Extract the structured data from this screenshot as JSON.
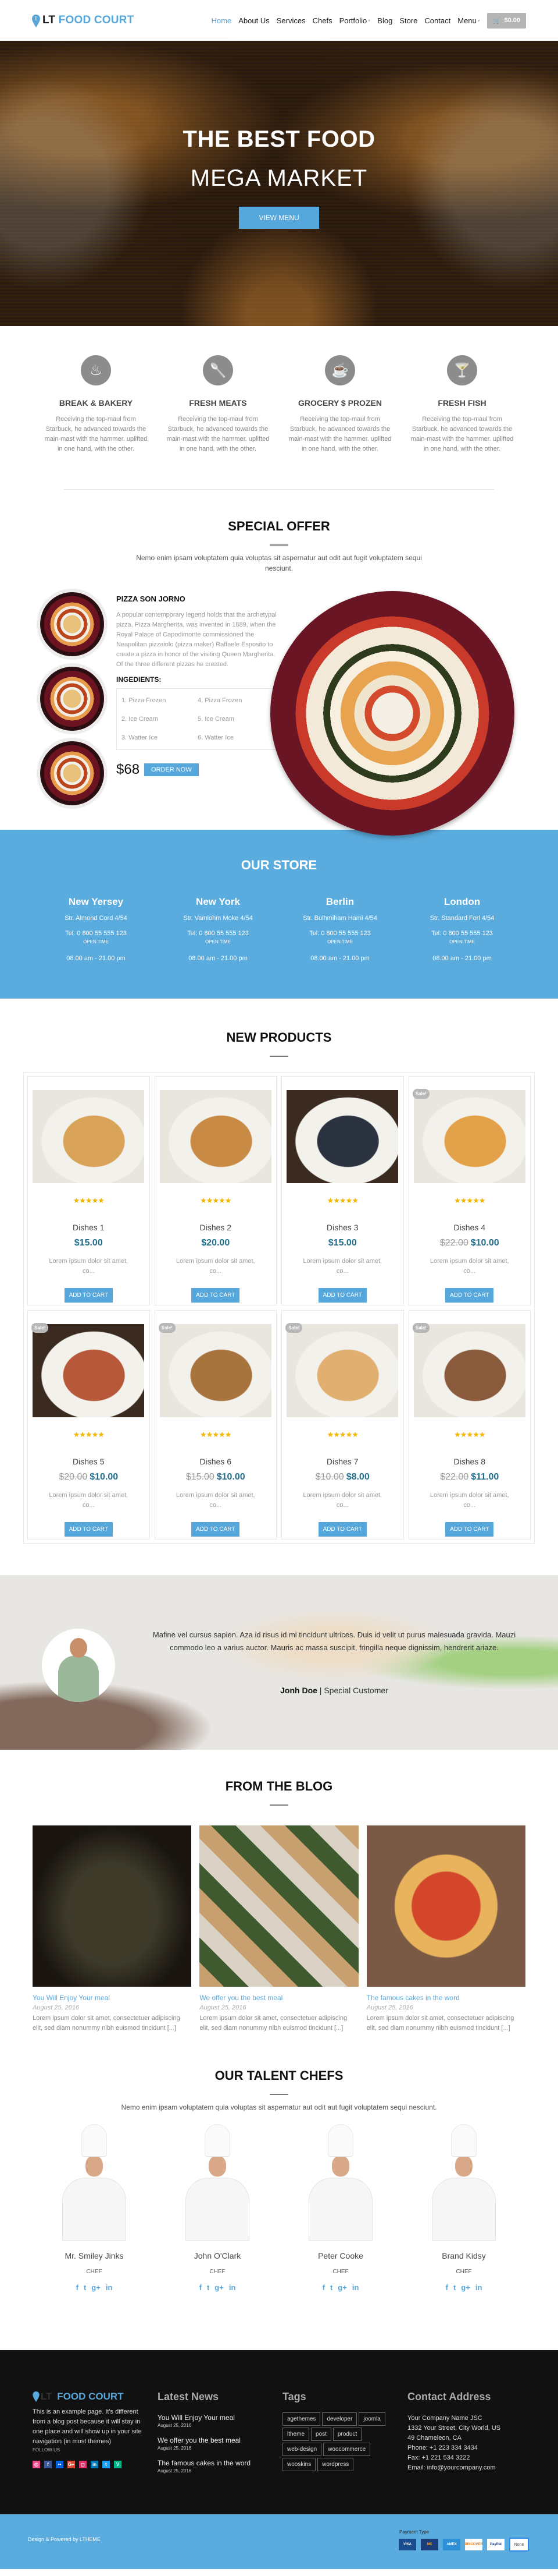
{
  "header": {
    "logo_lt": "LT",
    "logo_name": "FOOD COURT",
    "nav": [
      {
        "label": "Home",
        "active": true,
        "caret": false
      },
      {
        "label": "About Us",
        "active": false,
        "caret": false
      },
      {
        "label": "Services",
        "active": false,
        "caret": false
      },
      {
        "label": "Chefs",
        "active": false,
        "caret": false
      },
      {
        "label": "Portfolio",
        "active": false,
        "caret": true
      },
      {
        "label": "Blog",
        "active": false,
        "caret": false
      },
      {
        "label": "Store",
        "active": false,
        "caret": false
      },
      {
        "label": "Contact",
        "active": false,
        "caret": false
      },
      {
        "label": "Menu",
        "active": false,
        "caret": true
      }
    ],
    "cart_total": "$0.00",
    "cart_icon": "cart-icon"
  },
  "hero": {
    "title": "THE BEST FOOD",
    "subtitle": "MEGA MARKET",
    "button": "VIEW MENU"
  },
  "features": [
    {
      "icon": "flame-icon",
      "title": "BREAK & BAKERY",
      "text": "Receiving the top-maul from Starbuck, he advanced towards the main-mast with the hammer. uplifted in one hand, with the other."
    },
    {
      "icon": "spoon-icon",
      "title": "FRESH MEATS",
      "text": "Receiving the top-maul from Starbuck, he advanced towards the main-mast with the hammer. uplifted in one hand, with the other."
    },
    {
      "icon": "coffee-cup-icon",
      "title": "GROCERY $ PROZEN",
      "text": "Receiving the top-maul from Starbuck, he advanced towards the main-mast with the hammer. uplifted in one hand, with the other."
    },
    {
      "icon": "cocktail-icon",
      "title": "FRESH FISH",
      "text": "Receiving the top-maul from Starbuck, he advanced towards the main-mast with the hammer. uplifted in one hand, with the other."
    }
  ],
  "special_offer": {
    "title": "SPECIAL OFFER",
    "description": "Nemo enim ipsam voluptatem quia voluptas sit aspernatur aut odit aut fugit voluptatem sequi nesciunt.",
    "item_name": "PIZZA SON JORNO",
    "item_description": "A popular contemporary legend holds that the archetypal pizza, Pizza Margherita, was invented in 1889, when the Royal Palace of Capodimonte commissioned the Neapolitan pizzaiolo (pizza maker) Raffaele Esposito to create a pizza in honor of the visiting Queen Margherita. Of the three different pizzas he created.",
    "ingredients_title": "INGEDIENTS:",
    "ingredients": [
      "1. Pizza Frozen",
      "4. Pizza Frozen",
      "2. Ice Cream",
      "5. Ice Cream",
      "3. Watter Ice",
      "6. Watter Ice"
    ],
    "price": "$68",
    "order_button": "ORDER NOW"
  },
  "store": {
    "title": "OUR STORE",
    "locations": [
      {
        "city": "New Yersey",
        "address": "Str. Almond Cord 4/54",
        "tel": "Tel: 0 800 55 555 123",
        "open_label": "OPEN TIME",
        "hours": "08.00 am - 21.00 pm"
      },
      {
        "city": "New York",
        "address": "Str. Vamlohm Moke 4/54",
        "tel": "Tel: 0 800 55 555 123",
        "open_label": "OPEN TIME",
        "hours": "08.00 am - 21.00 pm"
      },
      {
        "city": "Berlin",
        "address": "Str. Bulhmiham Hami 4/54",
        "tel": "Tel: 0 800 55 555 123",
        "open_label": "OPEN TIME",
        "hours": "08.00 am - 21.00 pm"
      },
      {
        "city": "London",
        "address": "Str. Standard Forl 4/54",
        "tel": "Tel: 0 800 55 555 123",
        "open_label": "OPEN TIME",
        "hours": "08.00 am - 21.00 pm"
      }
    ]
  },
  "products": {
    "title": "NEW PRODUCTS",
    "sale_label": "Sale!",
    "add_to_cart": "ADD TO CART",
    "items": [
      {
        "name": "Dishes 1",
        "old_price": "",
        "price": "$15.00",
        "rating": 5,
        "sale": false,
        "desc": "Lorem ipsum dolor sit amet, co...",
        "color": "#d9a35a"
      },
      {
        "name": "Dishes 2",
        "old_price": "",
        "price": "$20.00",
        "rating": 5,
        "sale": false,
        "desc": "Lorem ipsum dolor sit amet, co...",
        "color": "#c98a45"
      },
      {
        "name": "Dishes 3",
        "old_price": "",
        "price": "$15.00",
        "rating": 5,
        "sale": false,
        "desc": "Lorem ipsum dolor sit amet, co...",
        "color": "#2b3340"
      },
      {
        "name": "Dishes 4",
        "old_price": "$22.00",
        "price": "$10.00",
        "rating": 5,
        "sale": true,
        "desc": "Lorem ipsum dolor sit amet, co...",
        "color": "#e3a24a"
      },
      {
        "name": "Dishes 5",
        "old_price": "$20.00",
        "price": "$10.00",
        "rating": 5,
        "sale": true,
        "desc": "Lorem ipsum dolor sit amet, co...",
        "color": "#b8583a"
      },
      {
        "name": "Dishes 6",
        "old_price": "$15.00",
        "price": "$10.00",
        "rating": 5,
        "sale": true,
        "desc": "Lorem ipsum dolor sit amet, co...",
        "color": "#a8743e"
      },
      {
        "name": "Dishes 7",
        "old_price": "$10.00",
        "price": "$8.00",
        "rating": 5,
        "sale": true,
        "desc": "Lorem ipsum dolor sit amet, co...",
        "color": "#e1b070"
      },
      {
        "name": "Dishes 8",
        "old_price": "$22.00",
        "price": "$11.00",
        "rating": 5,
        "sale": true,
        "desc": "Lorem ipsum dolor sit amet, co...",
        "color": "#8a5a3c"
      }
    ]
  },
  "testimonial": {
    "quote": "Mafine vel cursus sapien. Aza id risus id mi tincidunt ultrices. Duis id velit ut purus malesuada gravida. Mauzi commodo leo a varius auctor. Mauris ac massa suscipit, fringilla neque dignissim, hendrerit ariaze.",
    "author": "Jonh Doe",
    "role": "Special Customer"
  },
  "blog": {
    "title": "FROM THE BLOG",
    "posts": [
      {
        "title": "You Will Enjoy Your meal",
        "date": "August 25, 2016",
        "excerpt": "Lorem ipsum dolor sit amet, consectetuer adipiscing elit, sed diam nonummy nibh euismod tincidunt [...]",
        "color": "#3d3a2a"
      },
      {
        "title": "We offer you the best meal",
        "date": "August 25, 2016",
        "excerpt": "Lorem ipsum dolor sit amet, consectetuer adipiscing elit, sed diam nonummy nibh euismod tincidunt [...]",
        "color": "#6a5a48"
      },
      {
        "title": "The famous cakes in the word",
        "date": "August 25, 2016",
        "excerpt": "Lorem ipsum dolor sit amet, consectetuer adipiscing elit, sed diam nonummy nibh euismod tincidunt [...]",
        "color": "#b5532e"
      }
    ]
  },
  "chefs": {
    "title": "OUR TALENT CHEFS",
    "description": "Nemo enim ipsam voluptatem quia voluptas sit aspernatur aut odit aut fugit voluptatem sequi nesciunt.",
    "members": [
      {
        "name": "Mr. Smiley Jinks",
        "role": "CHEF"
      },
      {
        "name": "John O'Clark",
        "role": "CHEF"
      },
      {
        "name": "Peter Cooke",
        "role": "CHEF"
      },
      {
        "name": "Brand Kidsy",
        "role": "CHEF"
      }
    ],
    "social": [
      "f",
      "t",
      "g+",
      "in"
    ]
  },
  "footer": {
    "logo_lt": "LT",
    "logo_name": "FOOD COURT",
    "about": "This is an example page. It's different from a blog post because it will stay in one place and will show up in your site navigation (in most themes)",
    "follow_label": "FOLLOW US",
    "socials": [
      {
        "name": "dribbble",
        "glyph": "◎",
        "color": "#ea4c89"
      },
      {
        "name": "facebook",
        "glyph": "f",
        "color": "#3b5998"
      },
      {
        "name": "flickr",
        "glyph": "••",
        "color": "#0063dc"
      },
      {
        "name": "google-plus",
        "glyph": "G+",
        "color": "#dd4b39"
      },
      {
        "name": "instagram",
        "glyph": "◻",
        "color": "#e1306c"
      },
      {
        "name": "linkedin",
        "glyph": "in",
        "color": "#0077b5"
      },
      {
        "name": "twitter",
        "glyph": "t",
        "color": "#1da1f2"
      },
      {
        "name": "vine",
        "glyph": "V",
        "color": "#00b488"
      }
    ],
    "news_title": "Latest News",
    "news": [
      {
        "title": "You Will Enjoy Your meal",
        "date": "August 25, 2016"
      },
      {
        "title": "We offer you the best meal",
        "date": "August 25, 2016"
      },
      {
        "title": "The famous cakes in the word",
        "date": "August 25, 2016"
      }
    ],
    "tags_title": "Tags",
    "tags": [
      "agethemes",
      "developer",
      "joomla",
      "ltheme",
      "post",
      "product",
      "web-design",
      "woocommerce",
      "wooskins",
      "wordpress"
    ],
    "contact_title": "Contact Address",
    "contact_lines": [
      "Your Company Name JSC",
      "1332 Your Street, City World, US",
      "49 Chameleon, CA",
      "Phone: +1 223 334 3434",
      "Fax: +1 221 534 3222",
      "Email: info@yourcompany.com"
    ],
    "credit": "Design & Powered by LTHEME",
    "payment_label": "Payment Type",
    "payments": [
      {
        "name": "VISA",
        "bg": "#1a4d8f",
        "fg": "#fff"
      },
      {
        "name": "MC",
        "bg": "#1a3e7a",
        "fg": "#f5a623"
      },
      {
        "name": "AMEX",
        "bg": "#2d8fd6",
        "fg": "#fff"
      },
      {
        "name": "DISCOVER",
        "bg": "#fff",
        "fg": "#e8791d"
      },
      {
        "name": "PayPal",
        "bg": "#fff",
        "fg": "#17387e"
      },
      {
        "name": "None",
        "bg": "#fff",
        "fg": "#444"
      }
    ]
  }
}
